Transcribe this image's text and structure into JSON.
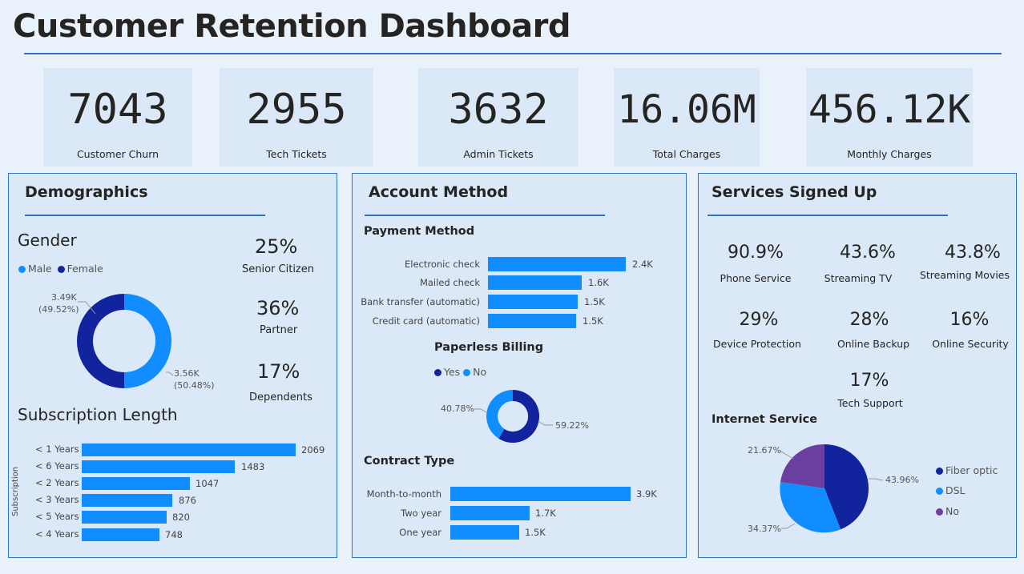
{
  "title": "Customer Retention Dashboard",
  "kpis": [
    {
      "value": "7043",
      "label": "Customer Churn"
    },
    {
      "value": "2955",
      "label": "Tech Tickets"
    },
    {
      "value": "3632",
      "label": "Admin Tickets"
    },
    {
      "value": "16.06M",
      "label": "Total Charges"
    },
    {
      "value": "456.12K",
      "label": "Monthly Charges"
    }
  ],
  "colors": {
    "light_blue": "#118dff",
    "dark_blue": "#12239e",
    "purple": "#6b3fa0",
    "accent": "#2f74c0"
  },
  "demographics": {
    "title": "Demographics",
    "gender": {
      "title": "Gender",
      "legend": [
        "Male",
        "Female"
      ],
      "female_label": "3.49K",
      "female_pct": "(49.52%)",
      "male_label": "3.56K",
      "male_pct": "(50.48%)"
    },
    "stats": [
      {
        "value": "25%",
        "label": "Senior Citizen"
      },
      {
        "value": "36%",
        "label": "Partner"
      },
      {
        "value": "17%",
        "label": "Dependents"
      }
    ],
    "subscription": {
      "title": "Subscription Length",
      "axis_label": "Subscription",
      "rows": [
        {
          "label": "< 1 Years",
          "value": "2069"
        },
        {
          "label": "< 6 Years",
          "value": "1483"
        },
        {
          "label": "< 2 Years",
          "value": "1047"
        },
        {
          "label": "< 3 Years",
          "value": "876"
        },
        {
          "label": "< 5 Years",
          "value": "820"
        },
        {
          "label": "< 4 Years",
          "value": "748"
        }
      ]
    }
  },
  "account": {
    "title": "Account Method",
    "payment": {
      "title": "Payment Method",
      "rows": [
        {
          "label": "Electronic check",
          "value": "2.4K"
        },
        {
          "label": "Mailed check",
          "value": "1.6K"
        },
        {
          "label": "Bank transfer (automatic)",
          "value": "1.5K"
        },
        {
          "label": "Credit card (automatic)",
          "value": "1.5K"
        }
      ]
    },
    "paperless": {
      "title": "Paperless Billing",
      "legend": [
        "Yes",
        "No"
      ],
      "no_label": "40.78%",
      "yes_label": "59.22%"
    },
    "contract": {
      "title": "Contract Type",
      "rows": [
        {
          "label": "Month-to-month",
          "value": "3.9K"
        },
        {
          "label": "Two year",
          "value": "1.7K"
        },
        {
          "label": "One year",
          "value": "1.5K"
        }
      ]
    }
  },
  "services": {
    "title": "Services Signed Up",
    "items": [
      {
        "value": "90.9%",
        "label": "Phone Service"
      },
      {
        "value": "43.6%",
        "label": "Streaming TV"
      },
      {
        "value": "43.8%",
        "label": "Streaming Movies"
      },
      {
        "value": "29%",
        "label": "Device Protection"
      },
      {
        "value": "28%",
        "label": "Online Backup"
      },
      {
        "value": "16%",
        "label": "Online Security"
      },
      {
        "value": "17%",
        "label": "Tech Support"
      }
    ],
    "internet": {
      "title": "Internet Service",
      "legend": [
        "Fiber optic",
        "DSL",
        "No"
      ],
      "fiber_label": "43.96%",
      "dsl_label": "34.37%",
      "no_label": "21.67%"
    }
  }
}
